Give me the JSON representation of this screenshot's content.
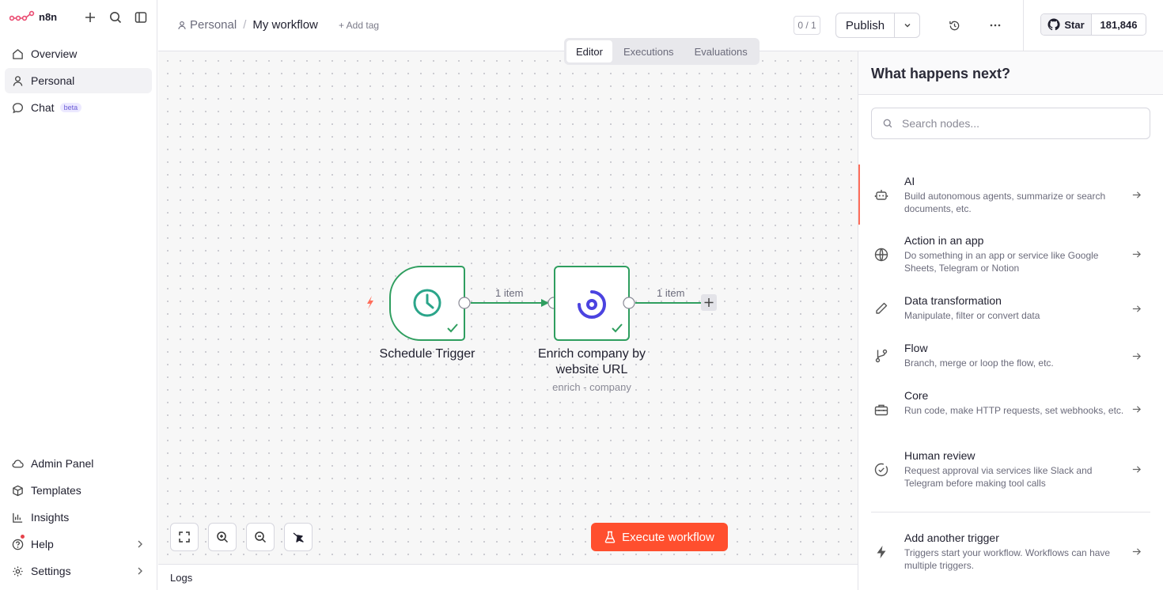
{
  "app": {
    "logo_text": "n8n"
  },
  "sidebar": {
    "top_items": [
      {
        "label": "Overview",
        "icon": "home-icon"
      },
      {
        "label": "Personal",
        "icon": "user-icon"
      },
      {
        "label": "Chat",
        "icon": "chat-icon",
        "badge": "beta"
      }
    ],
    "bottom_items": [
      {
        "label": "Admin Panel",
        "icon": "cloud-icon"
      },
      {
        "label": "Templates",
        "icon": "box-icon"
      },
      {
        "label": "Insights",
        "icon": "bar-chart-icon"
      },
      {
        "label": "Help",
        "icon": "help-icon"
      },
      {
        "label": "Settings",
        "icon": "gear-icon"
      }
    ]
  },
  "header": {
    "breadcrumb_project": "Personal",
    "breadcrumb_separator": "/",
    "workflow_name": "My workflow",
    "add_tag": "+ Add tag",
    "counter": "0 / 1",
    "publish_label": "Publish",
    "github_star": "Star",
    "github_count": "181,846"
  },
  "tabs": [
    "Editor",
    "Executions",
    "Evaluations"
  ],
  "canvas": {
    "nodes": [
      {
        "label": "Schedule Trigger",
        "icon": "clock-icon"
      },
      {
        "label": "Enrich company by website URL",
        "subtitle": "enrich - company",
        "icon": "brand-swirl-icon"
      }
    ],
    "edges": [
      "1 item",
      "1 item"
    ],
    "execute_label": "Execute workflow"
  },
  "logs": {
    "label": "Logs"
  },
  "panel": {
    "title": "What happens next?",
    "search_placeholder": "Search nodes...",
    "categories": [
      {
        "title": "AI",
        "desc": "Build autonomous agents, summarize or search documents, etc.",
        "icon": "robot-icon"
      },
      {
        "title": "Action in an app",
        "desc": "Do something in an app or service like Google Sheets, Telegram or Notion",
        "icon": "globe-icon"
      },
      {
        "title": "Data transformation",
        "desc": "Manipulate, filter or convert data",
        "icon": "pencil-icon"
      },
      {
        "title": "Flow",
        "desc": "Branch, merge or loop the flow, etc.",
        "icon": "git-branch-icon"
      },
      {
        "title": "Core",
        "desc": "Run code, make HTTP requests, set webhooks, etc.",
        "icon": "toolbox-icon"
      },
      {
        "title": "Human review",
        "desc": "Request approval via services like Slack and Telegram before making tool calls",
        "icon": "check-circle-icon"
      }
    ],
    "trigger": {
      "title": "Add another trigger",
      "desc": "Triggers start your workflow. Workflows can have multiple triggers.",
      "icon": "bolt-icon"
    }
  },
  "colors": {
    "accent": "#ff6d5a",
    "success": "#2f9e5f",
    "execute": "#ff4f2e",
    "brand_swirl": "#4b43e0"
  }
}
